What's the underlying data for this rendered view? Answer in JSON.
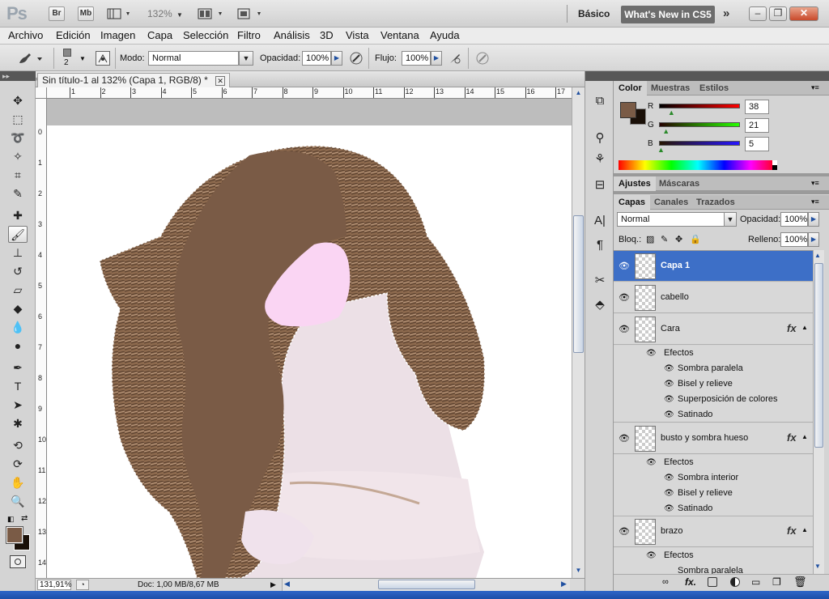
{
  "app": {
    "logo": "Ps",
    "bridge_btn": "Br",
    "minibridge_btn": "Mb",
    "zoom_select": "132%",
    "workspace": "Básico",
    "whats_new": "What's New in CS5",
    "colors": {
      "accent": "#3d6fc7",
      "chrome": "#d4d4d4",
      "dark_header": "#575757"
    }
  },
  "menu": [
    "Archivo",
    "Edición",
    "Imagen",
    "Capa",
    "Selección",
    "Filtro",
    "Análisis",
    "3D",
    "Vista",
    "Ventana",
    "Ayuda"
  ],
  "options": {
    "brush_size": "2",
    "mode_label": "Modo:",
    "mode_value": "Normal",
    "opacity_label": "Opacidad:",
    "opacity_value": "100%",
    "flow_label": "Flujo:",
    "flow_value": "100%"
  },
  "document": {
    "tab_title": "Sin título-1 al 132% (Capa 1, RGB/8) *",
    "ruler_h": [
      "1",
      "2",
      "3",
      "4",
      "5",
      "6",
      "7",
      "8",
      "9",
      "10",
      "11",
      "12",
      "13",
      "14",
      "15",
      "16",
      "17"
    ],
    "ruler_v": [
      "0",
      "1",
      "2",
      "3",
      "4",
      "5",
      "6",
      "7",
      "8",
      "9",
      "10",
      "11",
      "12",
      "13",
      "14"
    ],
    "zoom": "131,91%",
    "doc_info": "Doc: 1,00 MB/8,67 MB"
  },
  "color_panel": {
    "tabs": [
      "Color",
      "Muestras",
      "Estilos"
    ],
    "fg_color": "#7a5b46",
    "bg_color": "#1a1008",
    "r_label": "R",
    "r_value": "38",
    "r_fraction": 0.149,
    "g_label": "G",
    "g_value": "21",
    "g_fraction": 0.082,
    "b_label": "B",
    "b_value": "5",
    "b_fraction": 0.02
  },
  "adjust_tabs": [
    "Ajustes",
    "Máscaras"
  ],
  "layers_panel": {
    "tabs": [
      "Capas",
      "Canales",
      "Trazados"
    ],
    "blend_mode": "Normal",
    "opacity_label": "Opacidad:",
    "opacity_value": "100%",
    "lock_label": "Bloq.:",
    "fill_label": "Relleno:",
    "fill_value": "100%",
    "effects_label": "Efectos",
    "fx_label": "fx",
    "layers": [
      {
        "name": "Capa 1"
      },
      {
        "name": "cabello"
      },
      {
        "name": "Cara",
        "effects": [
          "Sombra paralela",
          "Bisel y relieve",
          "Superposición de colores",
          "Satinado"
        ]
      },
      {
        "name": "busto y sombra hueso",
        "effects": [
          "Sombra interior",
          "Bisel y relieve",
          "Satinado"
        ]
      },
      {
        "name": "brazo",
        "effects": [
          "Sombra paralela"
        ]
      }
    ]
  }
}
